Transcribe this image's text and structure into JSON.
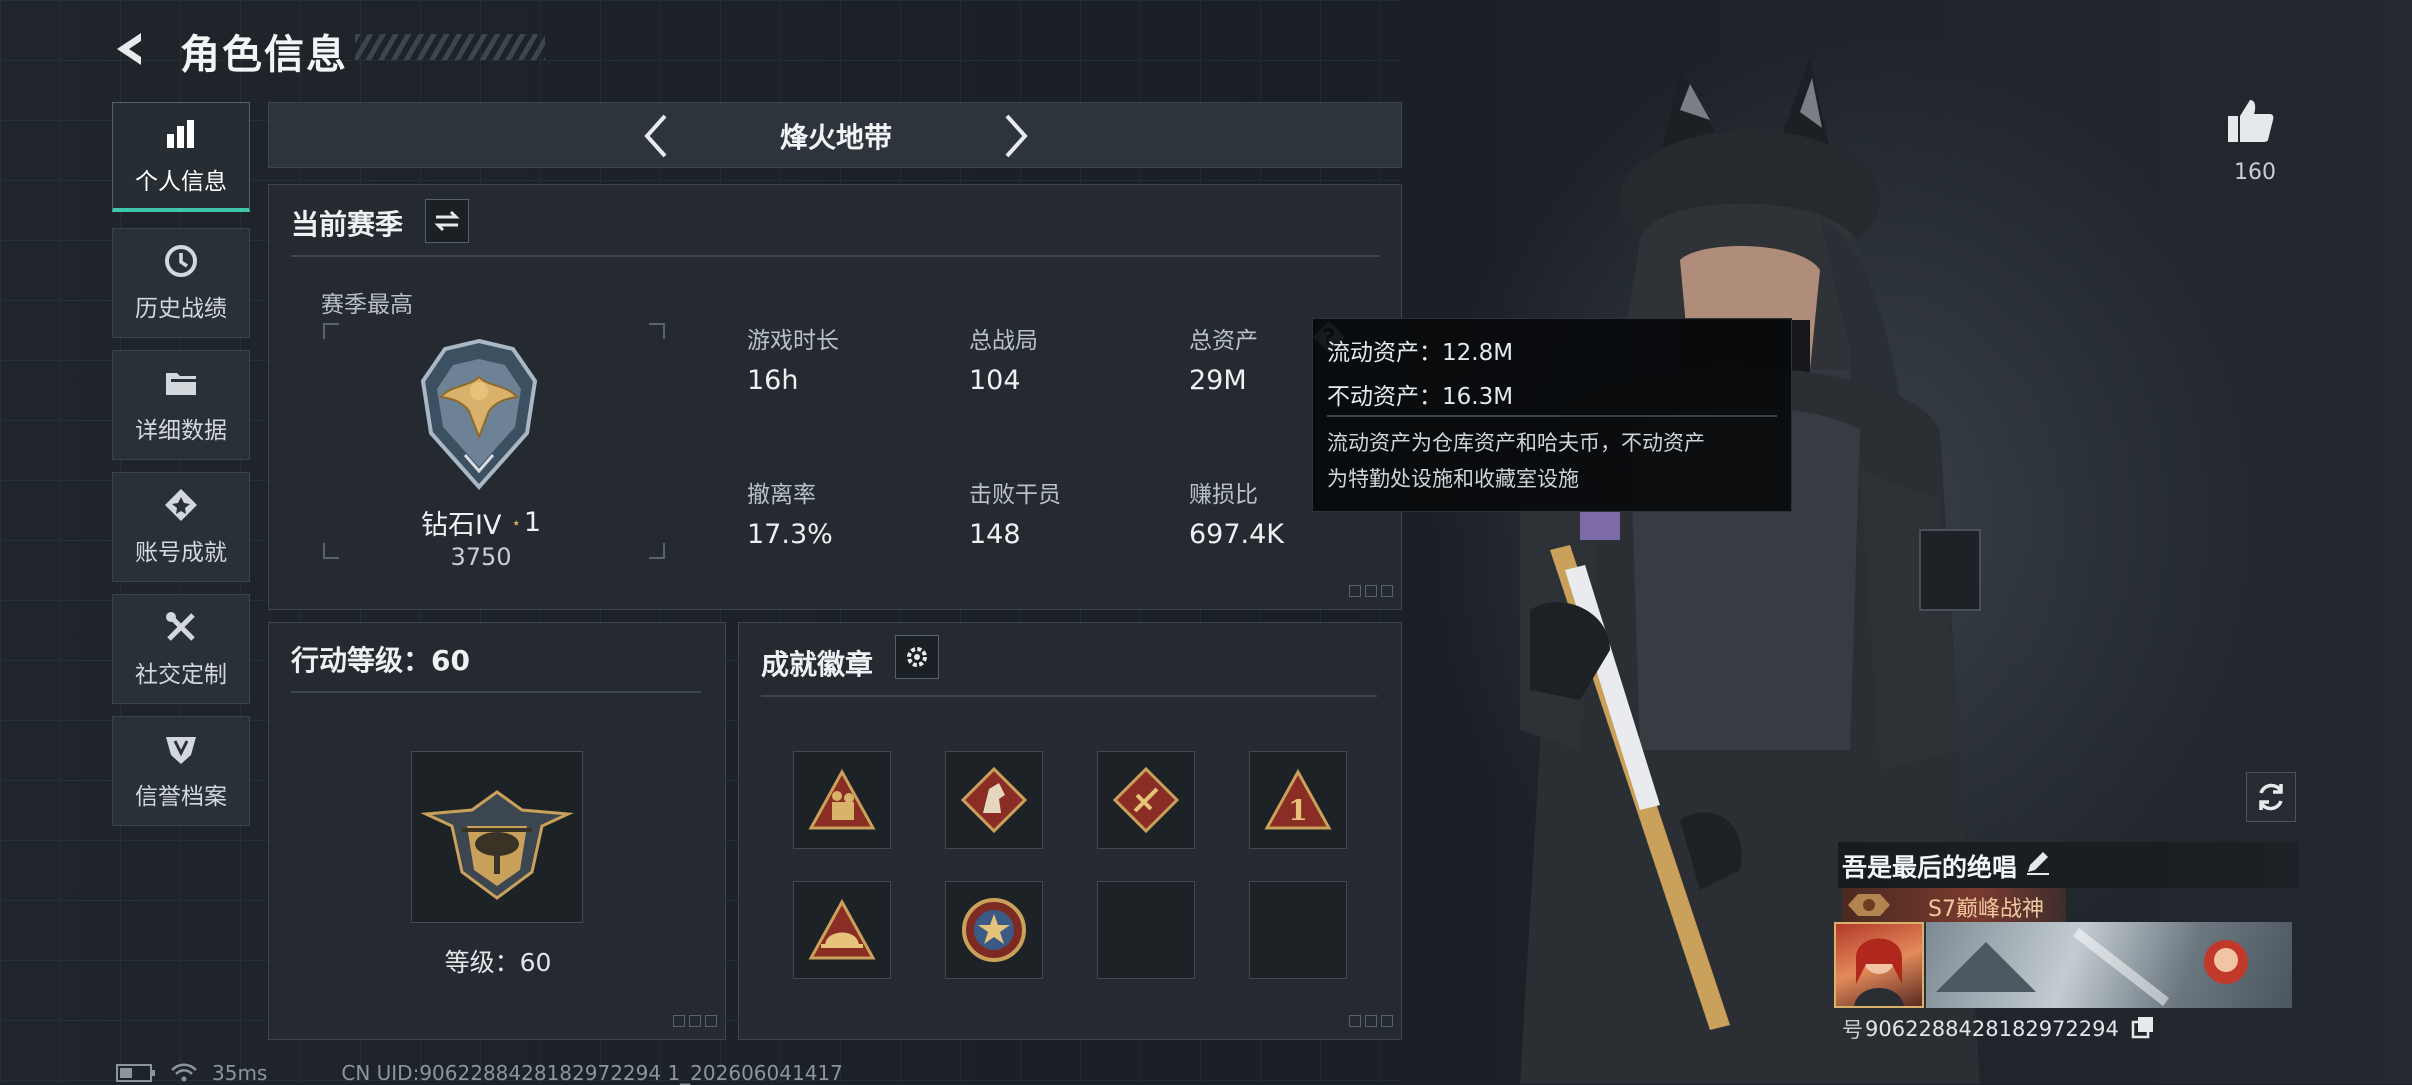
{
  "header": {
    "title": "角色信息"
  },
  "sidebar": {
    "items": [
      {
        "label": "个人信息",
        "icon": "bar-chart-icon",
        "active": true
      },
      {
        "label": "历史战绩",
        "icon": "clock-icon",
        "active": false
      },
      {
        "label": "详细数据",
        "icon": "folder-icon",
        "active": false
      },
      {
        "label": "账号成就",
        "icon": "achievement-icon",
        "active": false
      },
      {
        "label": "社交定制",
        "icon": "tools-icon",
        "active": false
      },
      {
        "label": "信誉档案",
        "icon": "shield-icon",
        "active": false
      }
    ]
  },
  "season_selector": {
    "name": "烽火地带"
  },
  "current_season": {
    "title": "当前赛季",
    "best_label": "赛季最高",
    "rank_name": "钻石IV",
    "rank_stars": "1",
    "rank_points": "3750",
    "stats": [
      {
        "label": "游戏时长",
        "value": "16h"
      },
      {
        "label": "总战局",
        "value": "104"
      },
      {
        "label": "总资产",
        "value": "29M"
      },
      {
        "label": "撤离率",
        "value": "17.3%"
      },
      {
        "label": "击败干员",
        "value": "148"
      },
      {
        "label": "赚损比",
        "value": "697.4K"
      }
    ]
  },
  "tooltip": {
    "liquid": "流动资产：12.8M",
    "fixed": "不动资产：16.3M",
    "desc_line1": "流动资产为仓库资产和哈夫币，不动资产",
    "desc_line2": "为特勤处设施和收藏室设施"
  },
  "action_level": {
    "title": "行动等级：60",
    "level_text": "等级：60"
  },
  "achievements": {
    "title": "成就徽章",
    "badge_count": 6,
    "slot_count": 8
  },
  "profile": {
    "likes": "160",
    "player_name": "吾是最后的绝唱",
    "title_badge": "S7巅峰战神",
    "uid": "9062288428182972294",
    "uid_prefix": "号"
  },
  "status_bar": {
    "ping": "35ms",
    "uid_line": "CN UID:9062288428182972294 1_202606041417"
  },
  "colors": {
    "accent": "#3ec7a8",
    "gold": "#c9a15a",
    "badge_red": "#8a2d24"
  }
}
